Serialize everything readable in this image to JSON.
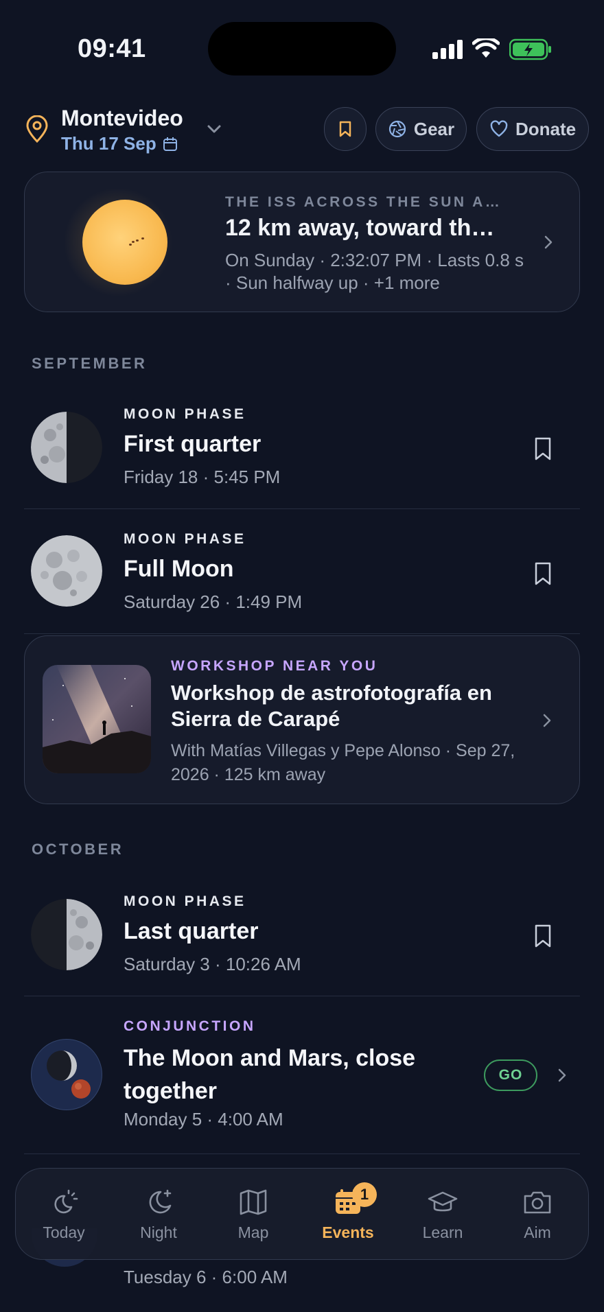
{
  "status": {
    "time": "09:41"
  },
  "header": {
    "city": "Montevideo",
    "date": "Thu 17 Sep",
    "gear_label": "Gear",
    "donate_label": "Donate"
  },
  "iss_card": {
    "kicker": "THE ISS ACROSS THE SUN A…",
    "title": "12 km away, toward th…",
    "subtitle": "On Sunday · 2:32:07 PM · Lasts 0.8 s · Sun halfway up · +1 more"
  },
  "sections": {
    "september": "SEPTEMBER",
    "october": "OCTOBER"
  },
  "events": [
    {
      "kicker": "MOON PHASE",
      "title": "First quarter",
      "meta": "Friday 18 · 5:45 PM"
    },
    {
      "kicker": "MOON PHASE",
      "title": "Full Moon",
      "meta": "Saturday 26 · 1:49 PM"
    },
    {
      "kicker": "MOON PHASE",
      "title": "Last quarter",
      "meta": "Saturday 3 · 10:26 AM"
    },
    {
      "kicker": "CONJUNCTION",
      "title": "The Moon and Mars, close together",
      "meta": "Monday 5 · 4:00 AM",
      "badge": "GO"
    }
  ],
  "workshop": {
    "kicker": "WORKSHOP NEAR YOU",
    "title": "Workshop de astrofotografía en Sierra de Carapé",
    "subtitle": "With Matías Villegas y Pepe Alonso · Sep 27, 2026 · 125 km away"
  },
  "peek": {
    "meta": "Tuesday 6 · 6:00 AM"
  },
  "tabs": [
    {
      "label": "Today",
      "icon": "sun-moon-icon"
    },
    {
      "label": "Night",
      "icon": "moon-star-icon"
    },
    {
      "label": "Map",
      "icon": "map-icon"
    },
    {
      "label": "Events",
      "icon": "calendar-icon",
      "badge": "1"
    },
    {
      "label": "Learn",
      "icon": "graduation-cap-icon"
    },
    {
      "label": "Aim",
      "icon": "camera-icon"
    }
  ],
  "colors": {
    "background": "#0f1423",
    "accent": "#f5b45a",
    "date_blue": "#8fb3e6",
    "workshop_purple": "#c7a6ff",
    "conjunction_purple": "#c7a6ff",
    "go_green": "#6fd192"
  }
}
